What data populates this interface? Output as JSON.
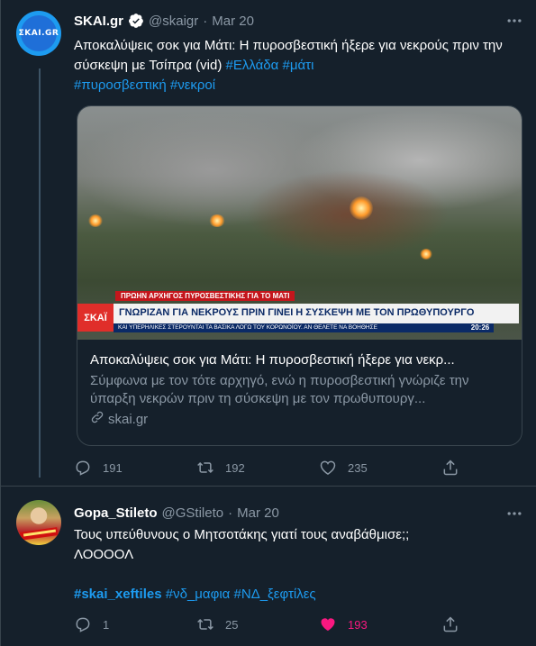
{
  "tweets": [
    {
      "avatar_text": "ΣΚΑΙ.GR",
      "display_name": "SKAI.gr",
      "handle": "@skaigr",
      "separator": "·",
      "date": "Mar 20",
      "text": "Αποκαλύψεις σοκ για Μάτι: Η πυροσβεστική ήξερε για νεκρούς πριν την σύσκεψη με Τσίπρα (vid) ",
      "hashtags": [
        "#Ελλάδα",
        "#μάτι",
        "#πυροσβεστική",
        "#νεκροί"
      ],
      "card": {
        "overlay_top": "ΠΡΩΗΝ ΑΡΧΗΓΟΣ ΠΥΡΟΣΒΕΣΤΙΚΗΣ ΓΙΑ ΤΟ ΜΑΤΙ",
        "overlay_logo": "ΣΚΑΪ",
        "overlay_main": "ΓΝΩΡΙΖΑΝ ΓΙΑ ΝΕΚΡΟΥΣ ΠΡΙΝ ΓΙΝΕΙ Η ΣΥΣΚΕΨΗ ΜΕ ΤΟΝ ΠΡΩΘΥΠΟΥΡΓΟ",
        "overlay_ticker": "ΚΑΙ ΥΠΕΡΗΛΙΚΕΣ ΣΤΕΡΟΥΝΤΑΙ ΤΑ ΒΑΣΙΚΑ ΛΟΓΩ ΤΟΥ ΚΟΡΩΝΟΪΟΥ. ΑΝ ΘΕΛΕΤΕ ΝΑ ΒΟΗΘΗΣΕ",
        "overlay_time": "20:26",
        "title": "Αποκαλύψεις σοκ για Μάτι: Η πυροσβεστική ήξερε για νεκρ...",
        "description": "Σύμφωνα με τον τότε αρχηγό, ενώ η πυροσβεστική γνώριζε την ύπαρξη νεκρών πριν τη σύσκεψη με τον πρωθυπουργ...",
        "domain": "skai.gr"
      },
      "actions": {
        "replies": "191",
        "retweets": "192",
        "likes": "235"
      }
    },
    {
      "display_name": "Gopa_Stileto",
      "handle": "@GStileto",
      "separator": "·",
      "date": "Mar 20",
      "text_line1": "Τους υπεύθυνους ο Μητσοτάκης γιατί τους αναβάθμισε;;",
      "text_line2": "ΛΟΟΟΟΛ",
      "hashtags": [
        "#skai_xeftiles",
        "#νδ_μαφια",
        "#ΝΔ_ξεφτίλες"
      ],
      "actions": {
        "replies": "1",
        "retweets": "25",
        "likes": "193"
      }
    }
  ],
  "colors": {
    "background": "#15202b",
    "accent": "#1d9bf0",
    "like": "#f91880",
    "muted": "#8b98a5"
  }
}
